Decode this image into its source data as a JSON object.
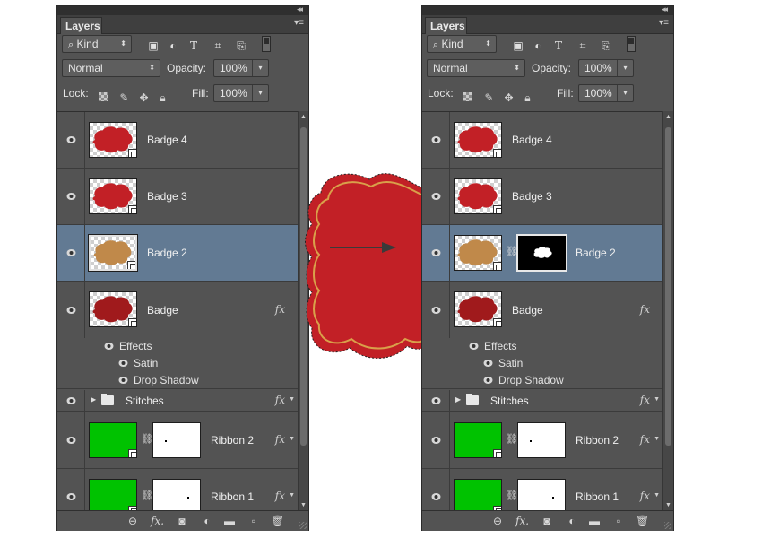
{
  "panel_title": "Layers",
  "filter": {
    "kind_label": "Kind",
    "icons": [
      "image-filter-icon",
      "adjustment-filter-icon",
      "type-filter-icon",
      "shape-filter-icon",
      "smart-object-filter-icon"
    ]
  },
  "blend_mode": "Normal",
  "opacity_label": "Opacity:",
  "opacity_value": "100%",
  "lock_label": "Lock:",
  "fill_label": "Fill:",
  "fill_value": "100%",
  "colors": {
    "panel_bg": "#535353",
    "selected_layer": "#627a93",
    "badge_red": "#c22026",
    "badge_dark_red": "#a01a1c",
    "badge_tan": "#c0894a",
    "ribbon_green": "#00c200"
  },
  "left": {
    "layers": [
      {
        "name": "Badge 4",
        "thumb": "red"
      },
      {
        "name": "Badge 3",
        "thumb": "red"
      },
      {
        "name": "Badge 2",
        "thumb": "tan",
        "selected": true
      },
      {
        "name": "Badge",
        "thumb": "darkred",
        "fx": "fx"
      }
    ],
    "effects_label": "Effects",
    "effects": [
      "Satin",
      "Drop Shadow"
    ],
    "group_name": "Stitches",
    "group_fx": "fx",
    "ribbons": [
      {
        "name": "Ribbon 2",
        "fx": "fx"
      },
      {
        "name": "Ribbon 1",
        "fx": "fx"
      }
    ]
  },
  "right": {
    "layers": [
      {
        "name": "Badge 4",
        "thumb": "red"
      },
      {
        "name": "Badge 3",
        "thumb": "red"
      },
      {
        "name": "Badge 2",
        "thumb": "tan",
        "selected": true,
        "mask": "black"
      },
      {
        "name": "Badge",
        "thumb": "darkred",
        "fx": "fx"
      }
    ],
    "effects_label": "Effects",
    "effects": [
      "Satin",
      "Drop Shadow"
    ],
    "group_name": "Stitches",
    "group_fx": "fx",
    "ribbons": [
      {
        "name": "Ribbon 2",
        "fx": "fx"
      },
      {
        "name": "Ribbon 1",
        "fx": "fx"
      }
    ]
  },
  "footer_icons": [
    "link-layers-icon",
    "add-style-icon",
    "add-mask-icon",
    "adjustment-layer-icon",
    "new-group-icon",
    "new-layer-icon",
    "delete-layer-icon"
  ]
}
